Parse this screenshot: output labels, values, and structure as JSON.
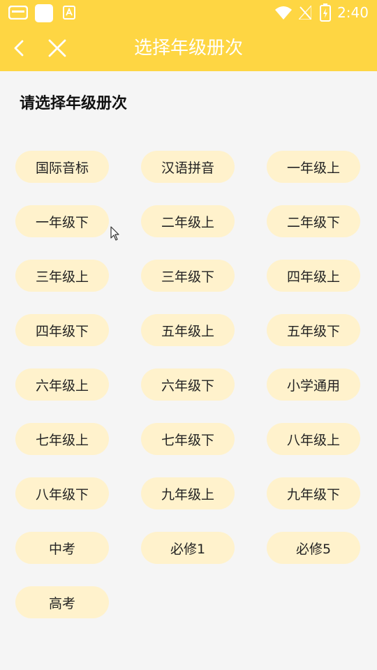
{
  "status_bar": {
    "time": "2:40",
    "icons": [
      "notification-icon",
      "app-square-icon",
      "store-icon",
      "wifi-icon",
      "no-signal-icon",
      "battery-charging-icon"
    ]
  },
  "header": {
    "title": "选择年级册次",
    "back_icon": "chevron-left-icon",
    "close_icon": "close-icon",
    "color": "#fed643"
  },
  "main": {
    "heading": "请选择年级册次",
    "grades": [
      "国际音标",
      "汉语拼音",
      "一年级上",
      "一年级下",
      "二年级上",
      "二年级下",
      "三年级上",
      "三年级下",
      "四年级上",
      "四年级下",
      "五年级上",
      "五年级下",
      "六年级上",
      "六年级下",
      "小学通用",
      "七年级上",
      "七年级下",
      "八年级上",
      "八年级下",
      "九年级上",
      "九年级下",
      "中考",
      "必修1",
      "必修5",
      "高考"
    ],
    "chip_color": "#fff2cc"
  }
}
